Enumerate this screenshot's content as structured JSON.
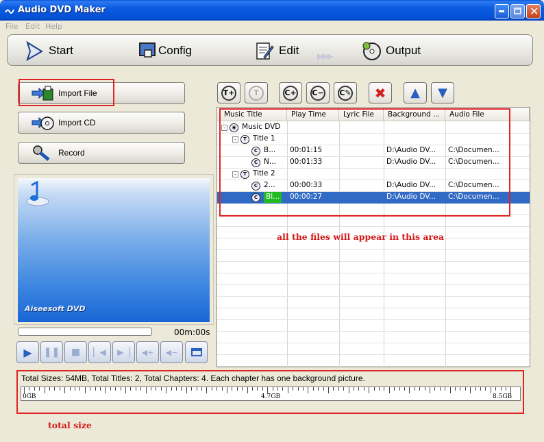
{
  "window": {
    "title": "Audio DVD Maker"
  },
  "menu": [
    "File",
    "Edit",
    "Help"
  ],
  "main_tabs": [
    {
      "label": "Start",
      "icon": "play-arrow-icon"
    },
    {
      "label": "Config",
      "icon": "config-monitor-icon"
    },
    {
      "label": "Edit",
      "icon": "edit-notepad-icon"
    },
    {
      "label": "Output",
      "icon": "output-disc-icon"
    }
  ],
  "left_buttons": [
    {
      "label": "Import File",
      "icon": "import-file-icon"
    },
    {
      "label": "Import CD",
      "icon": "import-cd-icon"
    },
    {
      "label": "Record",
      "icon": "microphone-icon"
    }
  ],
  "player": {
    "time": "00m:00s",
    "logo_text": "Aiseesoft DVD",
    "progress": 0
  },
  "file_grid": {
    "columns": [
      "Music Title",
      "Play Time",
      "Lyric File",
      "Background ...",
      "Audio File"
    ],
    "rows": [
      {
        "level": 0,
        "kind": "disc",
        "expander": "-",
        "title": "Music DVD",
        "time": "",
        "lyric": "",
        "background": "",
        "audio": ""
      },
      {
        "level": 1,
        "kind": "title",
        "expander": "-",
        "title": "Title 1",
        "time": "",
        "lyric": "",
        "background": "",
        "audio": ""
      },
      {
        "level": 2,
        "kind": "chapter",
        "expander": "",
        "title": "B...",
        "time": "00:01:15",
        "lyric": "",
        "background": "D:\\Audio DV...",
        "audio": "C:\\Documen..."
      },
      {
        "level": 2,
        "kind": "chapter",
        "expander": "",
        "title": "N...",
        "time": "00:01:33",
        "lyric": "",
        "background": "D:\\Audio DV...",
        "audio": "C:\\Documen..."
      },
      {
        "level": 1,
        "kind": "title",
        "expander": "-",
        "title": "Title 2",
        "time": "",
        "lyric": "",
        "background": "",
        "audio": ""
      },
      {
        "level": 2,
        "kind": "chapter",
        "expander": "",
        "title": "2...",
        "time": "00:00:33",
        "lyric": "",
        "background": "D:\\Audio DV...",
        "audio": "C:\\Documen..."
      },
      {
        "level": 2,
        "kind": "chapter",
        "expander": "",
        "title": "Bl...",
        "time": "00:00:27",
        "lyric": "",
        "background": "D:\\Audio DV...",
        "audio": "C:\\Documen...",
        "selected": true
      }
    ]
  },
  "annotations": {
    "files_area": "all  the files will appear in this area",
    "total_size": "total size"
  },
  "status": {
    "summary": "Total Sizes: 54MB, Total Titles: 2, Total Chapters: 4. Each chapter has one background picture.",
    "ruler_labels": [
      "0GB",
      "4.7GB",
      "8.5GB"
    ]
  },
  "colors": {
    "annotation_red": "#e02424",
    "selection_blue": "#316ac5",
    "selection_green": "#22b922"
  }
}
